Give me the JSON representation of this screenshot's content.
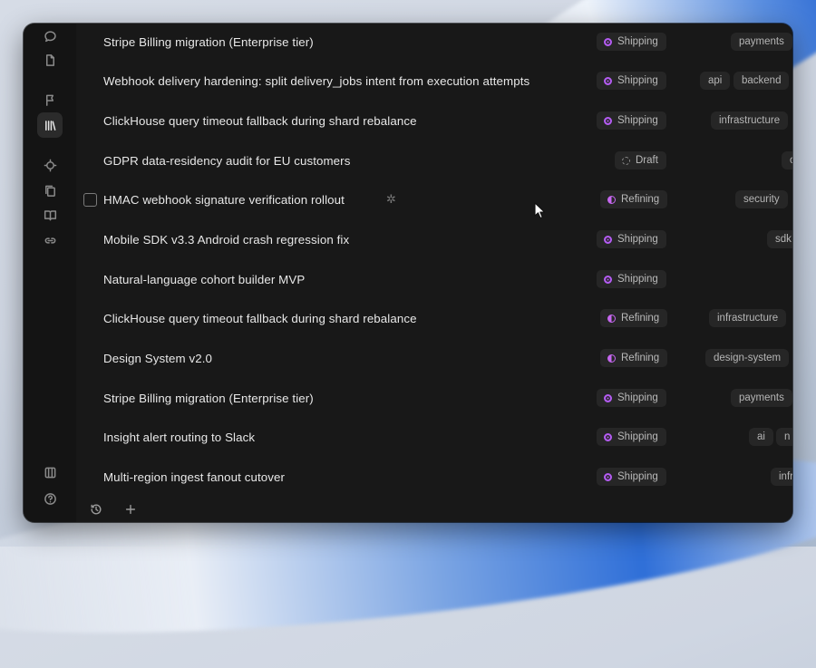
{
  "rail": {
    "icons": [
      "chat-bubble-icon",
      "document-icon",
      "flag-icon",
      "library-icon",
      "crosshair-icon",
      "copy-icon",
      "book-icon",
      "link-icon",
      "panel-icon",
      "help-icon"
    ]
  },
  "colors": {
    "shipping": "#b45cf2",
    "refining": "#c667f0",
    "draft": "#8a8a8a",
    "window_bg": "#181818"
  },
  "rows": [
    {
      "title": "Stripe Billing migration (Enterprise tier)",
      "status": "Shipping",
      "tags": [
        "payments"
      ]
    },
    {
      "title": "Webhook delivery hardening: split delivery_jobs intent from execution attempts",
      "status": "Shipping",
      "tags": [
        "api",
        "backend"
      ]
    },
    {
      "title": "ClickHouse query timeout fallback during shard rebalance",
      "status": "Shipping",
      "tags": [
        "infrastructure"
      ]
    },
    {
      "title": "GDPR data-residency audit for EU customers",
      "status": "Draft",
      "tags": [
        "c"
      ]
    },
    {
      "title": "HMAC webhook signature verification rollout",
      "status": "Refining",
      "tags": [
        "security"
      ]
    },
    {
      "title": "Mobile SDK v3.3 Android crash regression fix",
      "status": "Shipping",
      "tags": [
        "sdk"
      ]
    },
    {
      "title": "Natural-language cohort builder MVP",
      "status": "Shipping",
      "tags": []
    },
    {
      "title": "ClickHouse query timeout fallback during shard rebalance",
      "status": "Refining",
      "tags": [
        "infrastructure"
      ]
    },
    {
      "title": "Design System v2.0",
      "status": "Refining",
      "tags": [
        "design-system"
      ]
    },
    {
      "title": "Stripe Billing migration (Enterprise tier)",
      "status": "Shipping",
      "tags": [
        "payments"
      ]
    },
    {
      "title": "Insight alert routing to Slack",
      "status": "Shipping",
      "tags": [
        "ai",
        "n"
      ]
    },
    {
      "title": "Multi-region ingest fanout cutover",
      "status": "Shipping",
      "tags": [
        "infr"
      ]
    }
  ],
  "bottom": {
    "history_icon": "history-icon",
    "add_icon": "plus-icon"
  }
}
